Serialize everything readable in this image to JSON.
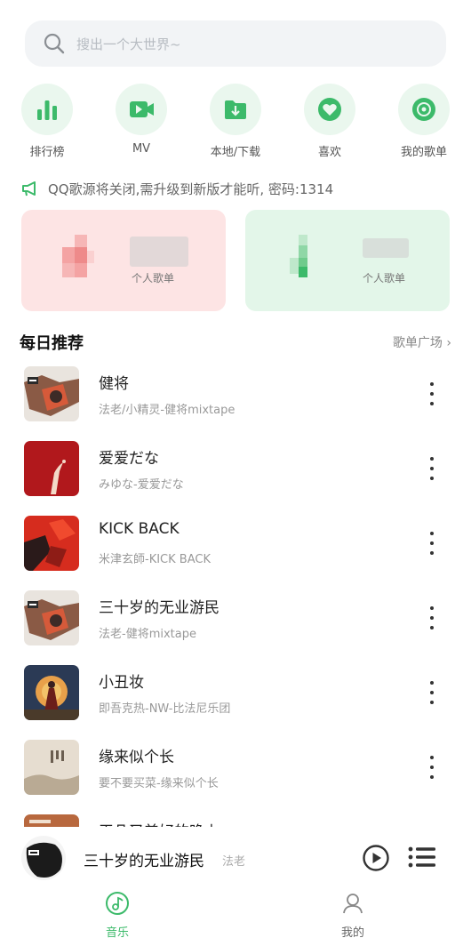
{
  "search": {
    "placeholder": "搜出一个大世界~"
  },
  "quick_actions": [
    {
      "label": "排行榜",
      "icon": "bar-chart-icon"
    },
    {
      "label": "MV",
      "icon": "video-icon"
    },
    {
      "label": "本地/下载",
      "icon": "download-folder-icon"
    },
    {
      "label": "喜欢",
      "icon": "heart-icon"
    },
    {
      "label": "我的歌单",
      "icon": "disc-icon"
    }
  ],
  "notice": {
    "text": "QQ歌源将关闭,需升级到新版才能听, 密码:1314"
  },
  "playlist_cards": [
    {
      "subtitle": "个人歌单",
      "color": "#fde4e4"
    },
    {
      "subtitle": "个人歌单",
      "color": "#e3f6e9"
    }
  ],
  "daily": {
    "title": "每日推荐",
    "link": "歌单广场 ›",
    "songs": [
      {
        "title": "健将",
        "subtitle": "法老/小精灵-健将mixtape"
      },
      {
        "title": "爱爱だな",
        "subtitle": "みゆな-爱爱だな"
      },
      {
        "title": "KICK BACK",
        "subtitle": "米津玄師-KICK BACK"
      },
      {
        "title": "三十岁的无业游民",
        "subtitle": "法老-健将mixtape"
      },
      {
        "title": "小丑妆",
        "subtitle": "即吾克热-NW-比法尼乐团"
      },
      {
        "title": "缘来似个长",
        "subtitle": "要不要买菜-缘来似个长"
      },
      {
        "title": "平凡又美好的晚上",
        "subtitle": ""
      }
    ]
  },
  "now_playing": {
    "title": "三十岁的无业游民",
    "artist": "法老"
  },
  "tabs": [
    {
      "label": "音乐",
      "active": true
    },
    {
      "label": "我的",
      "active": false
    }
  ],
  "colors": {
    "accent": "#3cba6a",
    "accent_light": "#eaf7ee"
  }
}
